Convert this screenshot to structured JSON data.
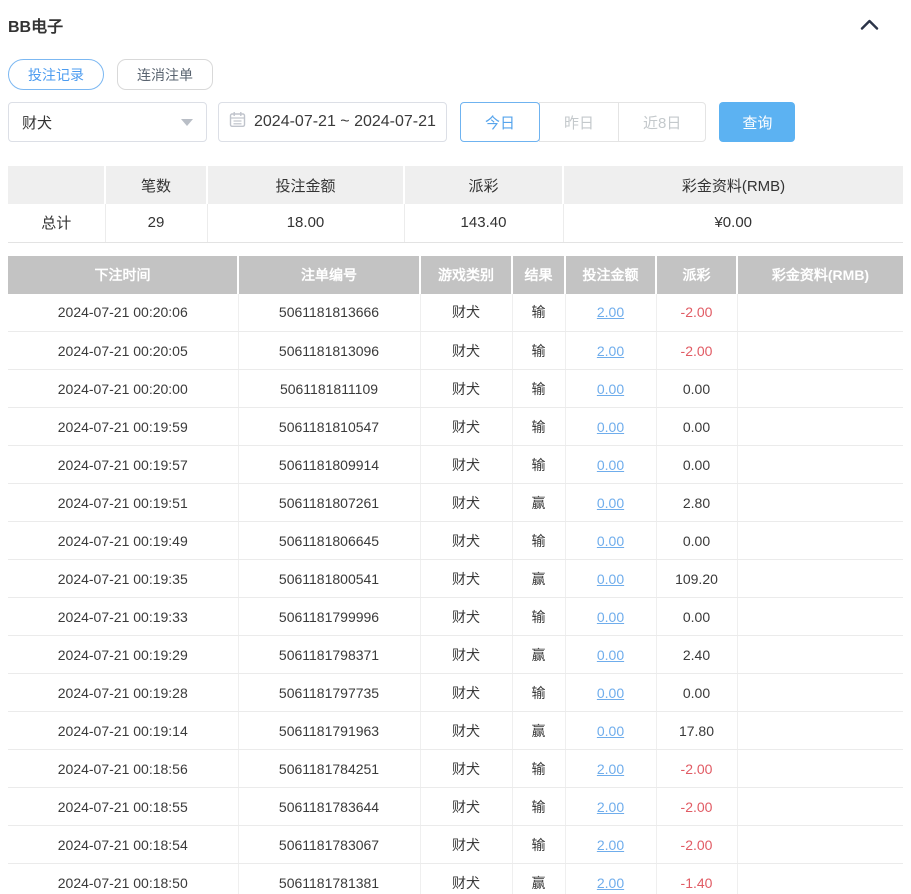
{
  "header": {
    "title": "BB电子"
  },
  "tabs": [
    {
      "label": "投注记录",
      "active": true
    },
    {
      "label": "连消注单",
      "active": false
    }
  ],
  "filters": {
    "game_select": {
      "value": "财犬"
    },
    "date_range": {
      "value": "2024-07-21 ~ 2024-07-21"
    },
    "quick_buttons": [
      {
        "label": "今日",
        "active": true
      },
      {
        "label": "昨日",
        "active": false
      },
      {
        "label": "近8日",
        "active": false
      }
    ],
    "search_label": "查询"
  },
  "summary": {
    "headers": [
      "",
      "笔数",
      "投注金额",
      "派彩",
      "彩金资料(RMB)"
    ],
    "row": {
      "label": "总计",
      "count": "29",
      "bet_amount": "18.00",
      "payout": "143.40",
      "bonus": "¥0.00"
    }
  },
  "table": {
    "headers": [
      "下注时间",
      "注单编号",
      "游戏类别",
      "结果",
      "投注金额",
      "派彩",
      "彩金资料(RMB)"
    ],
    "rows": [
      {
        "time": "2024-07-21 00:20:06",
        "order_no": "5061181813666",
        "game": "财犬",
        "result": "输",
        "bet": "2.00",
        "payout": "-2.00",
        "bonus": ""
      },
      {
        "time": "2024-07-21 00:20:05",
        "order_no": "5061181813096",
        "game": "财犬",
        "result": "输",
        "bet": "2.00",
        "payout": "-2.00",
        "bonus": ""
      },
      {
        "time": "2024-07-21 00:20:00",
        "order_no": "5061181811109",
        "game": "财犬",
        "result": "输",
        "bet": "0.00",
        "payout": "0.00",
        "bonus": ""
      },
      {
        "time": "2024-07-21 00:19:59",
        "order_no": "5061181810547",
        "game": "财犬",
        "result": "输",
        "bet": "0.00",
        "payout": "0.00",
        "bonus": ""
      },
      {
        "time": "2024-07-21 00:19:57",
        "order_no": "5061181809914",
        "game": "财犬",
        "result": "输",
        "bet": "0.00",
        "payout": "0.00",
        "bonus": ""
      },
      {
        "time": "2024-07-21 00:19:51",
        "order_no": "5061181807261",
        "game": "财犬",
        "result": "赢",
        "bet": "0.00",
        "payout": "2.80",
        "bonus": ""
      },
      {
        "time": "2024-07-21 00:19:49",
        "order_no": "5061181806645",
        "game": "财犬",
        "result": "输",
        "bet": "0.00",
        "payout": "0.00",
        "bonus": ""
      },
      {
        "time": "2024-07-21 00:19:35",
        "order_no": "5061181800541",
        "game": "财犬",
        "result": "赢",
        "bet": "0.00",
        "payout": "109.20",
        "bonus": ""
      },
      {
        "time": "2024-07-21 00:19:33",
        "order_no": "5061181799996",
        "game": "财犬",
        "result": "输",
        "bet": "0.00",
        "payout": "0.00",
        "bonus": ""
      },
      {
        "time": "2024-07-21 00:19:29",
        "order_no": "5061181798371",
        "game": "财犬",
        "result": "赢",
        "bet": "0.00",
        "payout": "2.40",
        "bonus": ""
      },
      {
        "time": "2024-07-21 00:19:28",
        "order_no": "5061181797735",
        "game": "财犬",
        "result": "输",
        "bet": "0.00",
        "payout": "0.00",
        "bonus": ""
      },
      {
        "time": "2024-07-21 00:19:14",
        "order_no": "5061181791963",
        "game": "财犬",
        "result": "赢",
        "bet": "0.00",
        "payout": "17.80",
        "bonus": ""
      },
      {
        "time": "2024-07-21 00:18:56",
        "order_no": "5061181784251",
        "game": "财犬",
        "result": "输",
        "bet": "2.00",
        "payout": "-2.00",
        "bonus": ""
      },
      {
        "time": "2024-07-21 00:18:55",
        "order_no": "5061181783644",
        "game": "财犬",
        "result": "输",
        "bet": "2.00",
        "payout": "-2.00",
        "bonus": ""
      },
      {
        "time": "2024-07-21 00:18:54",
        "order_no": "5061181783067",
        "game": "财犬",
        "result": "输",
        "bet": "2.00",
        "payout": "-2.00",
        "bonus": ""
      },
      {
        "time": "2024-07-21 00:18:50",
        "order_no": "5061181781381",
        "game": "财犬",
        "result": "赢",
        "bet": "2.00",
        "payout": "-1.40",
        "bonus": ""
      }
    ]
  },
  "colors": {
    "accent_blue": "#5cb2f2",
    "tab_active_blue": "#4d9cf0",
    "link_blue": "#6fadec",
    "negative_red": "#e15b64",
    "table_header_gray": "#c3c3c3",
    "summary_header_gray": "#efefef"
  }
}
